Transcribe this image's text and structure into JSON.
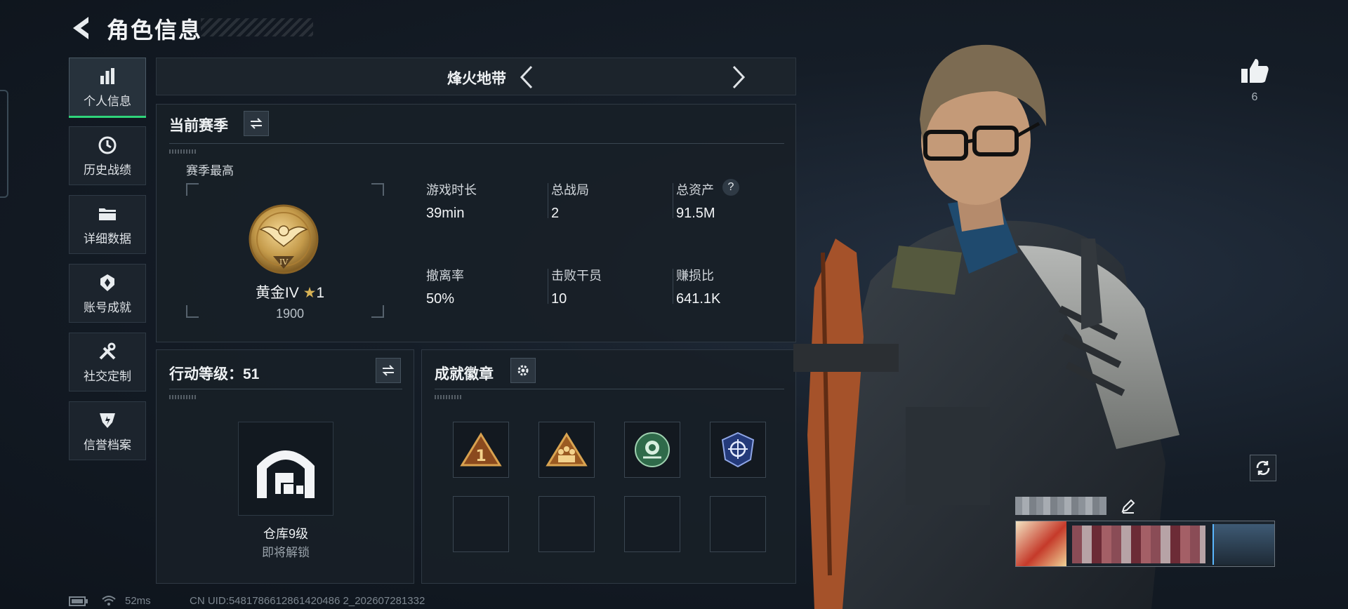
{
  "header": {
    "title": "角色信息"
  },
  "sidebar": {
    "items": [
      {
        "label": "个人信息",
        "icon": "bar-chart-icon",
        "active": true
      },
      {
        "label": "历史战绩",
        "icon": "history-clock-icon",
        "active": false
      },
      {
        "label": "详细数据",
        "icon": "folder-icon",
        "active": false
      },
      {
        "label": "账号成就",
        "icon": "achievement-icon",
        "active": false
      },
      {
        "label": "社交定制",
        "icon": "tools-icon",
        "active": false
      },
      {
        "label": "信誉档案",
        "icon": "shield-icon",
        "active": false
      }
    ]
  },
  "mode": {
    "title": "烽火地带"
  },
  "season": {
    "title": "当前赛季",
    "best_label": "赛季最高",
    "rank_name": "黄金IV",
    "rank_stars": "1",
    "rank_score": "1900",
    "stats": [
      {
        "label": "游戏时长",
        "value": "39min"
      },
      {
        "label": "总战局",
        "value": "2"
      },
      {
        "label": "总资产",
        "value": "91.5M"
      },
      {
        "label": "撤离率",
        "value": "50%"
      },
      {
        "label": "击败干员",
        "value": "10"
      },
      {
        "label": "赚损比",
        "value": "641.1K"
      }
    ],
    "help_icon": "?"
  },
  "level": {
    "title": "行动等级：51",
    "warehouse_label": "仓库9级",
    "warehouse_status": "即将解锁"
  },
  "badges": {
    "title": "成就徽章",
    "slots": [
      "rank-1-badge-icon",
      "squad-badge-icon",
      "rose-badge-icon",
      "crosshair-badge-icon",
      "",
      "",
      "",
      ""
    ]
  },
  "right": {
    "like_count": "6"
  },
  "footer": {
    "ping": "52ms",
    "uid": "CN UID:5481786612861420486 2_202607281332"
  },
  "colors": {
    "accent": "#2fd47a",
    "gold": "#c9a24b",
    "panel": "#181f27"
  }
}
